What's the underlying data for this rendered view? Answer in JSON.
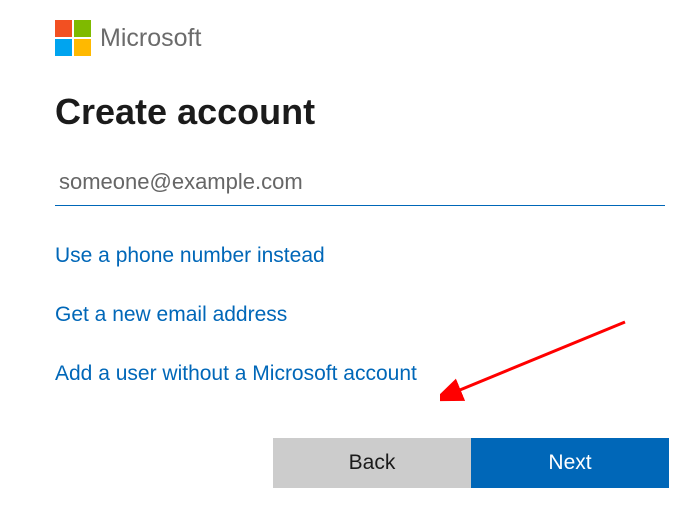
{
  "header": {
    "brand": "Microsoft"
  },
  "title": "Create account",
  "email": {
    "placeholder": "someone@example.com",
    "value": ""
  },
  "links": {
    "phone": "Use a phone number instead",
    "new_email": "Get a new email address",
    "no_account": "Add a user without a Microsoft account"
  },
  "buttons": {
    "back": "Back",
    "next": "Next"
  },
  "colors": {
    "accent": "#0067b8"
  }
}
